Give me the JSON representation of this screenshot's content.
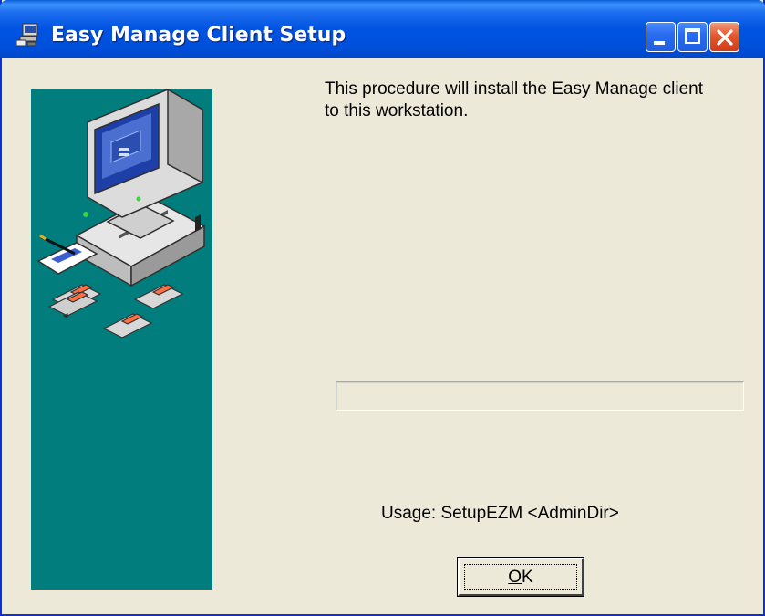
{
  "window": {
    "title": "Easy Manage Client Setup",
    "title_icon": "setup-computer-icon"
  },
  "titlebar_buttons": {
    "minimize_icon": "minimize-icon",
    "maximize_icon": "maximize-icon",
    "close_icon": "close-icon"
  },
  "side_panel": {
    "background_color": "#007d7c",
    "illustration": "computer-with-floppy-disks-illustration"
  },
  "main": {
    "intro_line1": "This procedure will install the Easy Manage client",
    "intro_line2": "to this workstation.",
    "progress": 0,
    "usage": "Usage: SetupEZM <AdminDir>"
  },
  "ok_button": {
    "label_mnemonic": "O",
    "label_rest": "K"
  },
  "colors": {
    "titlebar": "#0053e1",
    "dialog_bg": "#ece9d8",
    "close_button": "#e3582e"
  }
}
